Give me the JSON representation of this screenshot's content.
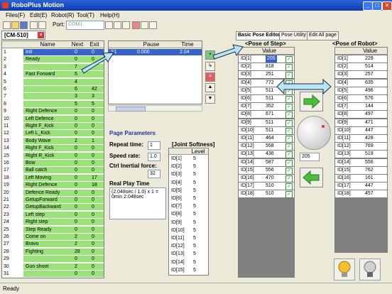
{
  "window": {
    "title": "RoboPlus Motion"
  },
  "menu": [
    "Files(F)",
    "Edit(E)",
    "Robot(R)",
    "Tool(T)",
    "Help(H)"
  ],
  "toolbar": {
    "port_label": "Port:",
    "port_value": "COM1"
  },
  "doc_tab": {
    "label": "[CM-510]"
  },
  "page_list": {
    "headers": [
      "Name",
      "Next",
      "Exit"
    ],
    "rows": [
      {
        "num": "1",
        "name": "Init",
        "next": "0",
        "exit": "0",
        "selected": true
      },
      {
        "num": "2",
        "name": "Ready",
        "next": "0",
        "exit": "0"
      },
      {
        "num": "3",
        "name": "",
        "next": "7",
        "exit": ""
      },
      {
        "num": "4",
        "name": "Fast Forward",
        "next": "5",
        "exit": ""
      },
      {
        "num": "5",
        "name": "",
        "next": "4",
        "exit": ""
      },
      {
        "num": "6",
        "name": "",
        "next": "6",
        "exit": "42"
      },
      {
        "num": "7",
        "name": "",
        "next": "3",
        "exit": "3"
      },
      {
        "num": "8",
        "name": "",
        "next": "5",
        "exit": "5"
      },
      {
        "num": "9",
        "name": "Right Defence",
        "next": "0",
        "exit": "0"
      },
      {
        "num": "10",
        "name": "Left Defence",
        "next": "0",
        "exit": "0"
      },
      {
        "num": "11",
        "name": "Right F_Kick",
        "next": "0",
        "exit": "0"
      },
      {
        "num": "12",
        "name": "Left L_Kick",
        "next": "0",
        "exit": "0"
      },
      {
        "num": "13",
        "name": "Body Wave",
        "next": "2",
        "exit": "1"
      },
      {
        "num": "14",
        "name": "Right F_Kick",
        "next": "0",
        "exit": "0"
      },
      {
        "num": "15",
        "name": "Right R_Kick",
        "next": "0",
        "exit": "0"
      },
      {
        "num": "16",
        "name": "Bow",
        "next": "0",
        "exit": "0"
      },
      {
        "num": "17",
        "name": "Ball catch",
        "next": "0",
        "exit": "0"
      },
      {
        "num": "18",
        "name": "Left Moving",
        "next": "0",
        "exit": "17"
      },
      {
        "num": "19",
        "name": "Right Defence",
        "next": "0",
        "exit": "18"
      },
      {
        "num": "20",
        "name": "Defence Ready",
        "next": "0",
        "exit": "0"
      },
      {
        "num": "21",
        "name": "GetupForward",
        "next": "0",
        "exit": "0"
      },
      {
        "num": "22",
        "name": "GetupBackward",
        "next": "0",
        "exit": "0"
      },
      {
        "num": "23",
        "name": "Left step",
        "next": "0",
        "exit": "0"
      },
      {
        "num": "24",
        "name": "Right step",
        "next": "0",
        "exit": "0"
      },
      {
        "num": "25",
        "name": "Step Ready",
        "next": "0",
        "exit": "0"
      },
      {
        "num": "26",
        "name": "Come on",
        "next": "2",
        "exit": "0"
      },
      {
        "num": "27",
        "name": "Bravo",
        "next": "2",
        "exit": "0"
      },
      {
        "num": "28",
        "name": "Fighting",
        "next": "28",
        "exit": "0"
      },
      {
        "num": "29",
        "name": "",
        "next": "0",
        "exit": "0"
      },
      {
        "num": "30",
        "name": "Gun shoot",
        "next": "2",
        "exit": "0"
      },
      {
        "num": "31",
        "name": "",
        "next": "0",
        "exit": "0"
      }
    ]
  },
  "step_list": {
    "headers": [
      "Pause",
      "Time"
    ],
    "rows": [
      {
        "num": "S1",
        "pause": "0.000",
        "time": "2.04"
      }
    ]
  },
  "page_params": {
    "title": "Page Parameters",
    "repeat_label": "Repeat time:",
    "repeat_value": "1",
    "speed_label": "Speed rate:",
    "speed_value": "1.0",
    "inertial_label": "Ctrl Inertial force:",
    "inertial_value": "32",
    "play_label": "Real Play Time",
    "play_text": "(2.048sec / 1.0) x 1 = 0min 2.048sec"
  },
  "joint_softness": {
    "title": "[Joint Softness]",
    "level_header": "Level",
    "rows": [
      {
        "id": "ID[1]",
        "level": "5"
      },
      {
        "id": "ID[2]",
        "level": "5"
      },
      {
        "id": "ID[3]",
        "level": "5"
      },
      {
        "id": "ID[4]",
        "level": "5"
      },
      {
        "id": "ID[5]",
        "level": "5"
      },
      {
        "id": "ID[6]",
        "level": "5"
      },
      {
        "id": "ID[7]",
        "level": "5"
      },
      {
        "id": "ID[8]",
        "level": "5"
      },
      {
        "id": "ID[9]",
        "level": "5"
      },
      {
        "id": "ID[10]",
        "level": "5"
      },
      {
        "id": "ID[11]",
        "level": "5"
      },
      {
        "id": "ID[12]",
        "level": "5"
      },
      {
        "id": "ID[13]",
        "level": "5"
      },
      {
        "id": "ID[14]",
        "level": "5"
      },
      {
        "id": "ID[15]",
        "level": "5"
      }
    ]
  },
  "tabs": [
    "Basic Pose Editor",
    "Pose Utility",
    "Edit All page"
  ],
  "pose_step": {
    "title": "<Pose of Step>",
    "value_header": "Value",
    "rows": [
      {
        "id": "ID[1]",
        "value": "205"
      },
      {
        "id": "ID[2]",
        "value": "818"
      },
      {
        "id": "ID[3]",
        "value": "251"
      },
      {
        "id": "ID[4]",
        "value": "772"
      },
      {
        "id": "ID[5]",
        "value": "511"
      },
      {
        "id": "ID[6]",
        "value": "511"
      },
      {
        "id": "ID[7]",
        "value": "352"
      },
      {
        "id": "ID[8]",
        "value": "671"
      },
      {
        "id": "ID[9]",
        "value": "511"
      },
      {
        "id": "ID[10]",
        "value": "511"
      },
      {
        "id": "ID[11]",
        "value": "464"
      },
      {
        "id": "ID[12]",
        "value": "558"
      },
      {
        "id": "ID[13]",
        "value": "436"
      },
      {
        "id": "ID[14]",
        "value": "587"
      },
      {
        "id": "ID[15]",
        "value": "556"
      },
      {
        "id": "ID[16]",
        "value": "470"
      },
      {
        "id": "ID[17]",
        "value": "510"
      },
      {
        "id": "ID[18]",
        "value": "510"
      }
    ]
  },
  "pose_robot": {
    "title": "<Pose of Robot>",
    "value_header": "Value",
    "rows": [
      {
        "id": "ID[1]",
        "value": "229"
      },
      {
        "id": "ID[2]",
        "value": "514"
      },
      {
        "id": "ID[3]",
        "value": "257"
      },
      {
        "id": "ID[4]",
        "value": "635"
      },
      {
        "id": "ID[5]",
        "value": "496"
      },
      {
        "id": "ID[6]",
        "value": "576"
      },
      {
        "id": "ID[7]",
        "value": "144"
      },
      {
        "id": "ID[8]",
        "value": "497"
      },
      {
        "id": "ID[9]",
        "value": "471"
      },
      {
        "id": "ID[10]",
        "value": "447"
      },
      {
        "id": "ID[11]",
        "value": "428"
      },
      {
        "id": "ID[12]",
        "value": "769"
      },
      {
        "id": "ID[13]",
        "value": "519"
      },
      {
        "id": "ID[14]",
        "value": "556"
      },
      {
        "id": "ID[15]",
        "value": "762"
      },
      {
        "id": "ID[16]",
        "value": "161"
      },
      {
        "id": "ID[17]",
        "value": "447"
      },
      {
        "id": "ID[18]",
        "value": "457"
      }
    ]
  },
  "dial": {
    "value": "205"
  },
  "status": {
    "text": "Ready"
  },
  "colors": {
    "green_row": "#9be27a",
    "selected_row": "#3563c8",
    "title_blue": "#1a4fc7",
    "arrow_fill": "#b7e5f5"
  }
}
